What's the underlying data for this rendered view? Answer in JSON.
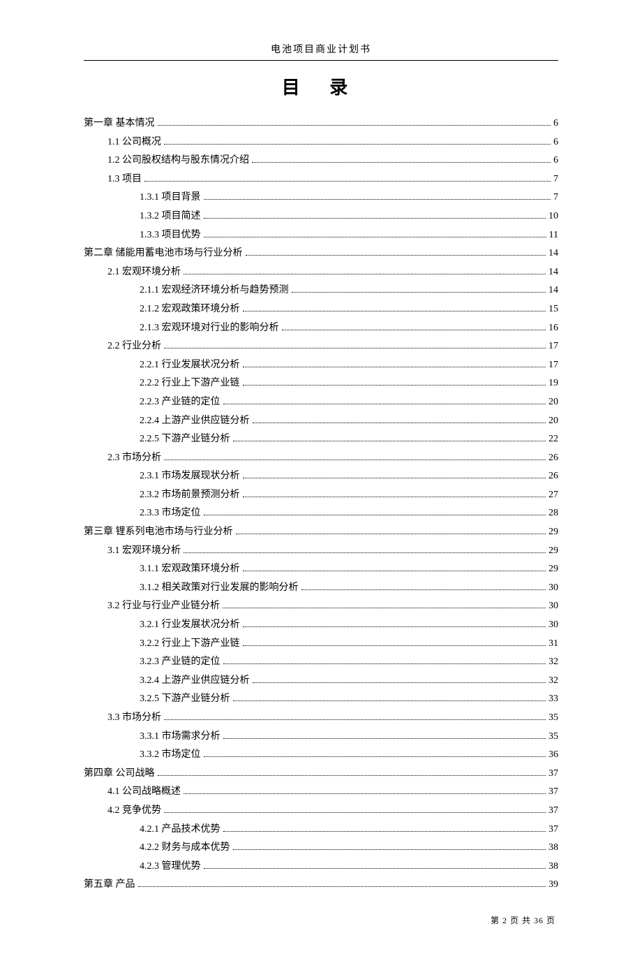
{
  "header": {
    "title": "电池项目商业计划书"
  },
  "toc_title": "目 录",
  "footer_text": "第 2 页 共 36 页",
  "toc": [
    {
      "label": "第一章  基本情况",
      "page": "6",
      "level": 0
    },
    {
      "label": "1.1 公司概况",
      "page": "6",
      "level": 1
    },
    {
      "label": "1.2 公司股权结构与股东情况介绍",
      "page": "6",
      "level": 1
    },
    {
      "label": "1.3 项目",
      "page": "7",
      "level": 1
    },
    {
      "label": "1.3.1 项目背景",
      "page": "7",
      "level": 2
    },
    {
      "label": "1.3.2 项目简述",
      "page": "10",
      "level": 2
    },
    {
      "label": "1.3.3 项目优势",
      "page": "11",
      "level": 2
    },
    {
      "label": "第二章  储能用蓄电池市场与行业分析",
      "page": "14",
      "level": 0
    },
    {
      "label": "2.1 宏观环境分析",
      "page": "14",
      "level": 1
    },
    {
      "label": "2.1.1 宏观经济环境分析与趋势预测",
      "page": "14",
      "level": 2
    },
    {
      "label": "2.1.2 宏观政策环境分析",
      "page": "15",
      "level": 2
    },
    {
      "label": "2.1.3 宏观环境对行业的影响分析",
      "page": "16",
      "level": 2
    },
    {
      "label": "2.2 行业分析",
      "page": "17",
      "level": 1
    },
    {
      "label": "2.2.1 行业发展状况分析",
      "page": "17",
      "level": 2
    },
    {
      "label": "2.2.2 行业上下游产业链",
      "page": "19",
      "level": 2
    },
    {
      "label": "2.2.3 产业链的定位",
      "page": "20",
      "level": 2
    },
    {
      "label": "2.2.4 上游产业供应链分析",
      "page": "20",
      "level": 2
    },
    {
      "label": "2.2.5 下游产业链分析",
      "page": "22",
      "level": 2
    },
    {
      "label": "2.3 市场分析",
      "page": "26",
      "level": 1
    },
    {
      "label": "2.3.1 市场发展现状分析",
      "page": "26",
      "level": 2
    },
    {
      "label": "2.3.2 市场前景预测分析",
      "page": "27",
      "level": 2
    },
    {
      "label": "2.3.3 市场定位",
      "page": "28",
      "level": 2
    },
    {
      "label": "第三章  锂系列电池市场与行业分析",
      "page": "29",
      "level": 0
    },
    {
      "label": "3.1 宏观环境分析",
      "page": "29",
      "level": 1
    },
    {
      "label": "3.1.1 宏观政策环境分析",
      "page": "29",
      "level": 2
    },
    {
      "label": "3.1.2 相关政策对行业发展的影响分析",
      "page": "30",
      "level": 2
    },
    {
      "label": "3.2 行业与行业产业链分析",
      "page": "30",
      "level": 1
    },
    {
      "label": "3.2.1 行业发展状况分析",
      "page": "30",
      "level": 2
    },
    {
      "label": "3.2.2 行业上下游产业链",
      "page": "31",
      "level": 2
    },
    {
      "label": "3.2.3 产业链的定位",
      "page": "32",
      "level": 2
    },
    {
      "label": "3.2.4 上游产业供应链分析",
      "page": "32",
      "level": 2
    },
    {
      "label": "3.2.5 下游产业链分析",
      "page": "33",
      "level": 2
    },
    {
      "label": "3.3 市场分析",
      "page": "35",
      "level": 1
    },
    {
      "label": "3.3.1 市场需求分析",
      "page": "35",
      "level": 2
    },
    {
      "label": "3.3.2 市场定位",
      "page": "36",
      "level": 2
    },
    {
      "label": "第四章  公司战略",
      "page": "37",
      "level": 0
    },
    {
      "label": "4.1 公司战略概述",
      "page": "37",
      "level": 1
    },
    {
      "label": "4.2 竞争优势",
      "page": "37",
      "level": 1
    },
    {
      "label": "4.2.1 产品技术优势",
      "page": "37",
      "level": 2
    },
    {
      "label": "4.2.2 财务与成本优势",
      "page": "38",
      "level": 2
    },
    {
      "label": "4.2.3 管理优势",
      "page": "38",
      "level": 2
    },
    {
      "label": "第五章  产品",
      "page": "39",
      "level": 0
    }
  ]
}
